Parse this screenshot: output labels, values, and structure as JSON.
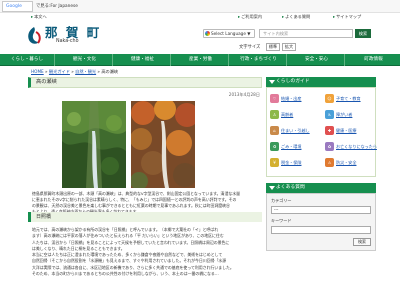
{
  "google": {
    "widget": "Google",
    "link": "で見る:For Japanese"
  },
  "toplinks": [
    "本文へ",
    "ご利用案内",
    "よくある質問",
    "サイトマップ"
  ],
  "site": {
    "name": "那 賀 町",
    "romaji": "Naka-cho"
  },
  "language": {
    "label": "Select Language",
    "arrow": "▼"
  },
  "search": {
    "placeholder": "サイト内検索",
    "button": "検索"
  },
  "font_size": {
    "label": "文字サイズ",
    "small": "標準",
    "large": "拡大"
  },
  "nav": [
    "くらし・暮らし",
    "観光・文化",
    "健康・福祉",
    "産業・労働",
    "行政・まちづくり",
    "安全・安心",
    "町政情報"
  ],
  "breadcrumb": {
    "items": [
      "HOME",
      "観光ガイド",
      "自然・観光"
    ],
    "current": "高の瀬峡",
    "sep": " » "
  },
  "page": {
    "title": "高の瀬峡",
    "date": "2013年4月28日"
  },
  "body": [
    "徳島県那賀町木頭出原の一部、木頭「高の瀬峡」は、典型的なV字型渓谷で、剣山国定公園となっています。清澄な水量",
    "に恵まれたそのV字に削られた渓谷は素晴らしく、特に、「もみじ」では四国随一との評判の声を高い評判です。その",
    "の景観は、天然の渓谷美と景色を楽しむ事ができるとともに紅葉の時期で見事であふれます。秋には町田洞窟峡谷",
    "もとより、遠く京阪神方面からの観光客も多く訪れてきます。"
  ],
  "subtitle": "日照橋",
  "body2": [
    "地元では、高の瀬峡から架かる有所の渓谷を「日照橋」と呼んでいます。（本郷で大葉社の「イ」と呼ばれ",
    "ます）高の瀬峡には平家の落人が住みついたと伝えられる「平 だいらい」という地区があり、この地区に住む",
    "人たちは、渓谷から「日照橋」を見ることによって天候を予想していたと言われています。日照橋は周辺の景色に",
    "は美しくなり、晴れた日に桐を見ることもできます。",
    "本当に空は人たちは正に澄まれた環境であったため、多くから鎌倉や夜間や自然などで、美術をはじめとして",
    "自然回帰（そこから自然役割を「水源機」も見えるまで、すぐや利用されていました。それが今日川回帰「水源",
    "大洋は実際では、流通は各自に、水区辺地区の新機であり、さらに多く共通での基底を使って利用され行いました。",
    "そのため、本当の町から川まであるとちの公共性の付けを利用しながら、いう、本土のは一番の橋になる…"
  ],
  "sidebar": {
    "head": "くらしのガイド",
    "items": [
      {
        "label": "結婚・出産",
        "icon": "rings-icon"
      },
      {
        "label": "子育て・教育",
        "icon": "child-icon"
      },
      {
        "label": "高齢者",
        "icon": "elder-icon"
      },
      {
        "label": "障がい者",
        "icon": "wheelchair-icon"
      },
      {
        "label": "住まい・引越し",
        "icon": "house-icon"
      },
      {
        "label": "健康・医療",
        "icon": "cross-icon"
      },
      {
        "label": "ごみ・環境",
        "icon": "recycle-icon"
      },
      {
        "label": "お亡くなりになったら",
        "icon": "flower-icon"
      },
      {
        "label": "税金・保険",
        "icon": "coin-icon"
      },
      {
        "label": "防災・安全",
        "icon": "shield-icon"
      }
    ]
  },
  "faq": {
    "head": "よくある質問",
    "category_label": "カテゴリー",
    "category_value": "---",
    "keyword_label": "キーワード",
    "button": "検索"
  },
  "colors": {
    "green": "#168f4f",
    "lightgreen": "#ebf3e3",
    "link": "#1a56b0"
  }
}
